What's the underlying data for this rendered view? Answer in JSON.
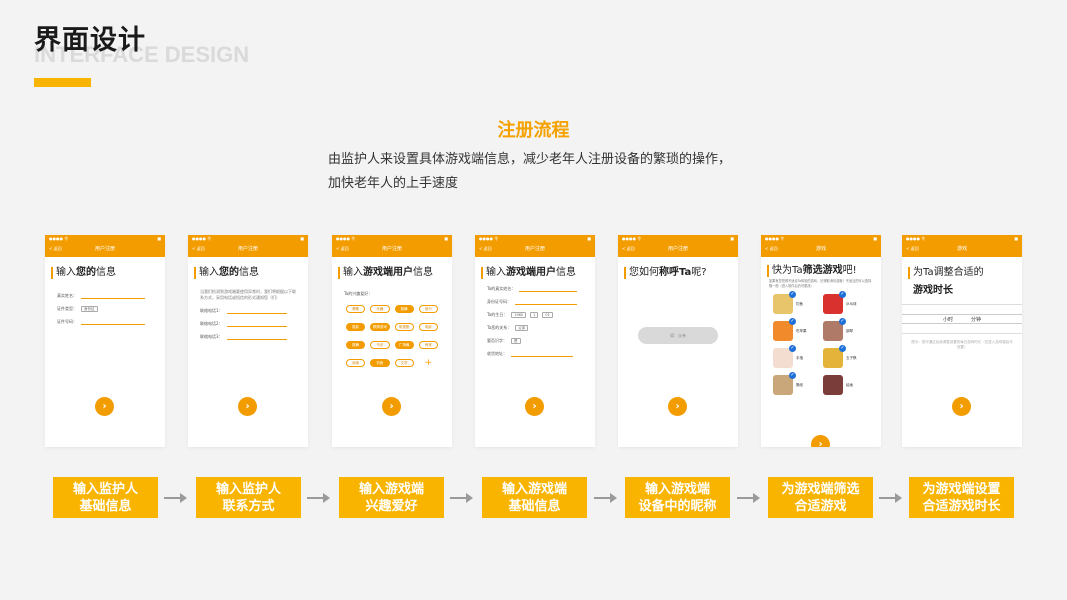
{
  "header": {
    "title": "界面设计",
    "subtitle": "INTERFACE DESIGN"
  },
  "section": {
    "title": "注册流程",
    "desc_line1": "由监护人来设置具体游戏端信息，减少老年人注册设备的繁琐的操作，",
    "desc_line2": "加快老年人的上手速度"
  },
  "colors": {
    "accent": "#f9b400",
    "phone_header": "#f39c00",
    "arrow": "#9a9a9a"
  },
  "phones": {
    "common": {
      "status_left": "●●●● 令",
      "status_right": "■",
      "back": "< 返回",
      "next_icon": "chevron-right-icon",
      "next_glyph": "›"
    },
    "p1": {
      "title": "用户注册",
      "heading_a": "输入",
      "heading_b": "您的",
      "heading_c": "信息",
      "fields": [
        "真实姓名：",
        "证件类型：",
        "证件号码："
      ],
      "id_type": "身份证"
    },
    "p2": {
      "title": "用户注册",
      "heading_a": "输入",
      "heading_b": "您的",
      "heading_c": "信息",
      "note": "当我们检测到游戏端要使用异常时，我们将根据以下联系方式，采用电话或短信的形式通知您（们）",
      "fields": [
        "联络电话1：",
        "联络电话2：",
        "联络电话3："
      ]
    },
    "p3": {
      "title": "用户注册",
      "heading_a": "输入",
      "heading_b": "游戏端用户",
      "heading_c": "信息",
      "question": "Ta的兴趣爱好：",
      "tags": [
        "唱歌",
        "乐器",
        "跳舞",
        "旅行",
        "摄影",
        "棋牌游戏",
        "电视剧",
        "电影",
        "跳舞",
        "书法",
        "广场舞",
        "养宠",
        "阅读",
        "钓鱼",
        "文学",
        "+"
      ]
    },
    "p4": {
      "title": "用户注册",
      "heading_a": "输入",
      "heading_b": "游戏端用户",
      "heading_c": "信息",
      "name_label": "Ta的真实姓名：",
      "id_label": "身份证号码：",
      "birth_label": "Ta的生日：",
      "year": "1960",
      "month": "1",
      "day": "01",
      "id_type_label": "Ta您的关系：",
      "id_type": "父亲",
      "mode_label": "要否识字：",
      "mode": "是",
      "addr_label": "收货地址："
    },
    "p5": {
      "title": "用户注册",
      "heading_a": "您如何",
      "heading_b": "称呼Ta",
      "heading_c": "呢?",
      "pill": "如：父亲"
    },
    "p6": {
      "title": "游戏",
      "heading_a": "快为Ta",
      "heading_b": "筛选游戏",
      "heading_c": "吧!",
      "note": "如果有您觉得不适合Ta体验的游戏，记得取消勾选哦！不适当的可以选择随一般（进入软件后仍可更改）",
      "games": [
        "钓鱼",
        "乒乓球",
        "吃苹果",
        "钢琴",
        "手指",
        "五子棋",
        "撕纸",
        "绘画"
      ]
    },
    "p7": {
      "title": "游戏",
      "heading_a": "为Ta",
      "heading_b": "调整合适的",
      "heading_c": "游戏时长",
      "hour_unit": "小时",
      "min_unit": "分钟",
      "note": "提示：您可通过后续调整设置的每日游戏时长（仅进入游戏端后可设置）"
    }
  },
  "steps": [
    {
      "line1": "输入监护人",
      "line2": "基础信息"
    },
    {
      "line1": "输入监护人",
      "line2": "联系方式"
    },
    {
      "line1": "输入游戏端",
      "line2": "兴趣爱好"
    },
    {
      "line1": "输入游戏端",
      "line2": "基础信息"
    },
    {
      "line1": "输入游戏端",
      "line2": "设备中的昵称"
    },
    {
      "line1": "为游戏端筛选",
      "line2": "合适游戏"
    },
    {
      "line1": "为游戏端设置",
      "line2": "合适游戏时长"
    }
  ]
}
